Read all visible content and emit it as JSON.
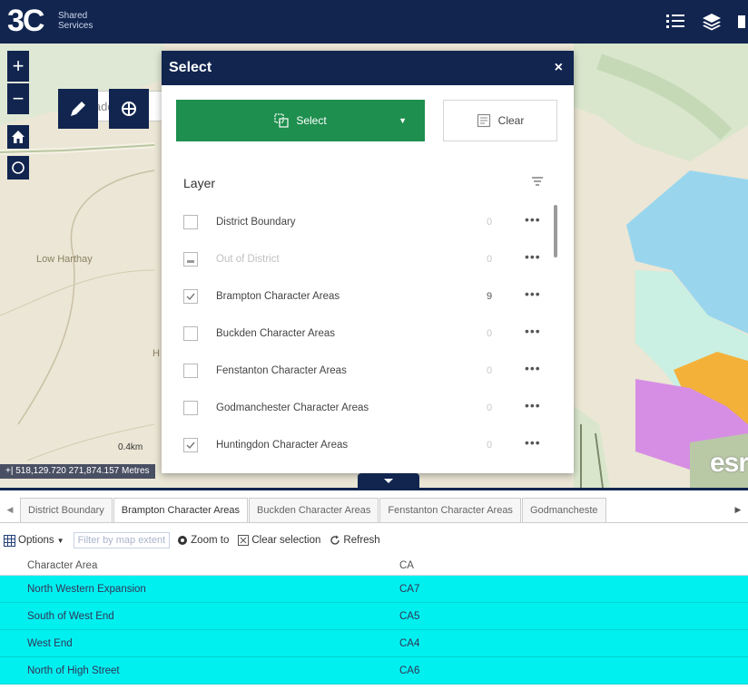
{
  "header": {
    "logo_main": "3C",
    "logo_sub_1": "Shared",
    "logo_sub_2": "Services"
  },
  "map": {
    "search_placeholder": "Find address",
    "place_label_1": "Low Harthay",
    "place_label_2": "H",
    "scale_label": "0.4km",
    "coordinates": "+| 518,129.720 271,874.157 Metres",
    "attribution": "esri"
  },
  "select_panel": {
    "title": "Select",
    "close": "×",
    "select_label": "Select",
    "clear_label": "Clear",
    "layer_header": "Layer",
    "layers": [
      {
        "name": "District Boundary",
        "count": "0",
        "checked": false,
        "disabled": false
      },
      {
        "name": "Out of District",
        "count": "0",
        "checked": false,
        "disabled": true
      },
      {
        "name": "Brampton Character Areas",
        "count": "9",
        "checked": true,
        "disabled": false
      },
      {
        "name": "Buckden Character Areas",
        "count": "0",
        "checked": false,
        "disabled": false
      },
      {
        "name": "Fenstanton Character Areas",
        "count": "0",
        "checked": false,
        "disabled": false
      },
      {
        "name": "Godmanchester Character Areas",
        "count": "0",
        "checked": false,
        "disabled": false
      },
      {
        "name": "Huntingdon Character Areas",
        "count": "0",
        "checked": true,
        "disabled": false
      }
    ],
    "more_label": "•••"
  },
  "attribute_table": {
    "tabs": [
      {
        "label": "District Boundary",
        "active": false
      },
      {
        "label": "Brampton Character Areas",
        "active": true
      },
      {
        "label": "Buckden Character Areas",
        "active": false
      },
      {
        "label": "Fenstanton Character Areas",
        "active": false
      },
      {
        "label": "Godmancheste",
        "active": false
      }
    ],
    "toolbar": {
      "options": "Options",
      "filter": "Filter by map extent",
      "zoom_to": "Zoom to",
      "clear_selection": "Clear selection",
      "refresh": "Refresh"
    },
    "columns": [
      "Character Area",
      "CA"
    ],
    "rows": [
      [
        "North Western Expansion",
        "CA7"
      ],
      [
        "South of West End",
        "CA5"
      ],
      [
        "West End",
        "CA4"
      ],
      [
        "North of High Street",
        "CA6"
      ]
    ]
  },
  "colors": {
    "navy": "#11254f",
    "select_green": "#1e8f4e",
    "row_selected": "#00f0f0"
  }
}
